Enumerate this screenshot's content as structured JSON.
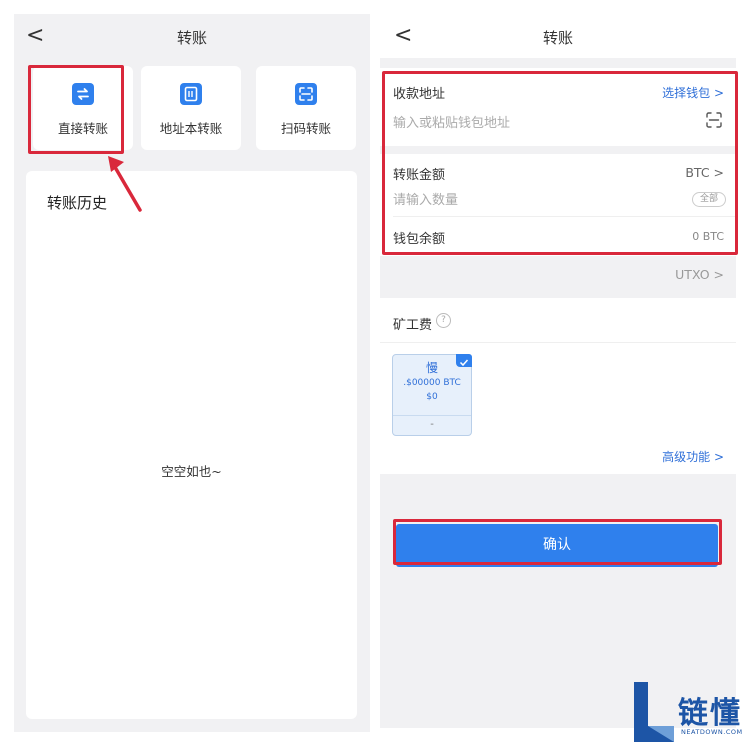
{
  "left_screen": {
    "title": "转账",
    "back_glyph": "<",
    "actions": [
      {
        "label": "直接转账",
        "icon": "swap-arrows-icon"
      },
      {
        "label": "地址本转账",
        "icon": "address-book-icon"
      },
      {
        "label": "扫码转账",
        "icon": "scan-icon"
      }
    ],
    "history": {
      "title": "转账历史",
      "empty_text": "空空如也~"
    }
  },
  "right_screen": {
    "title": "转账",
    "back_glyph": "<",
    "recipient": {
      "label": "收款地址",
      "choose_wallet": "选择钱包 >",
      "placeholder": "输入或粘贴钱包地址"
    },
    "amount": {
      "label": "转账金额",
      "currency": "BTC >",
      "placeholder": "请输入数量",
      "all_chip": "全部"
    },
    "balance": {
      "label": "钱包余额",
      "value": "0 BTC"
    },
    "utxo": "UTXO >",
    "miner_fee": {
      "label": "矿工费",
      "help_glyph": "?",
      "option": {
        "speed": "慢",
        "amount": ".$00000 BTC",
        "usd": "$0",
        "time": "-"
      }
    },
    "advanced": "高级功能 >",
    "confirm": "确认"
  },
  "watermark": {
    "text_cn": "链懂",
    "text_en": "NEATDOWN.COM"
  },
  "colors": {
    "accent": "#2f80ed",
    "highlight": "#d9283b",
    "background": "#f1f1f3",
    "logo": "#1d55a6"
  }
}
